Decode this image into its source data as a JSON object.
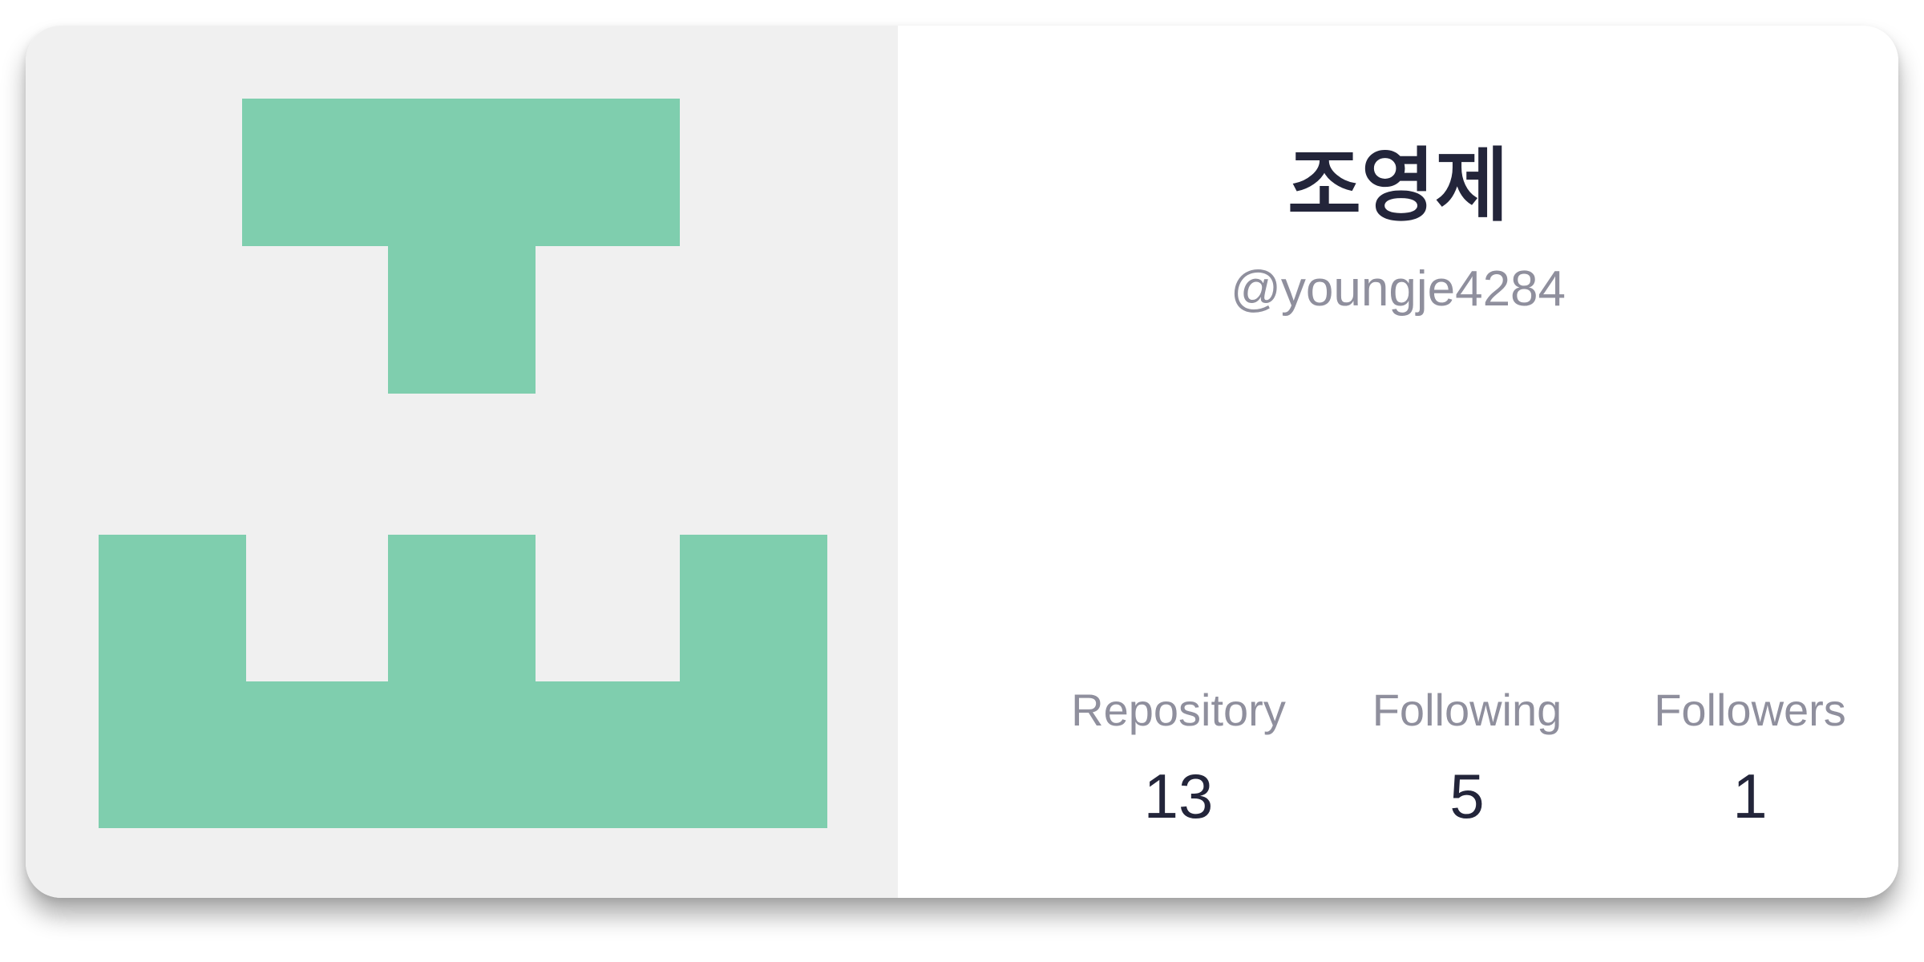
{
  "profile": {
    "name": "조영제",
    "handle": "@youngje4284"
  },
  "avatar": {
    "icon": "identicon",
    "foreground_color": "#7fceae",
    "background_color": "#f0f0f0"
  },
  "stats": [
    {
      "label": "Repository",
      "value": "13"
    },
    {
      "label": "Following",
      "value": "5"
    },
    {
      "label": "Followers",
      "value": "1"
    }
  ],
  "colors": {
    "name_text": "#23253a",
    "muted_text": "#8f8f9d",
    "card_background": "#ffffff"
  }
}
